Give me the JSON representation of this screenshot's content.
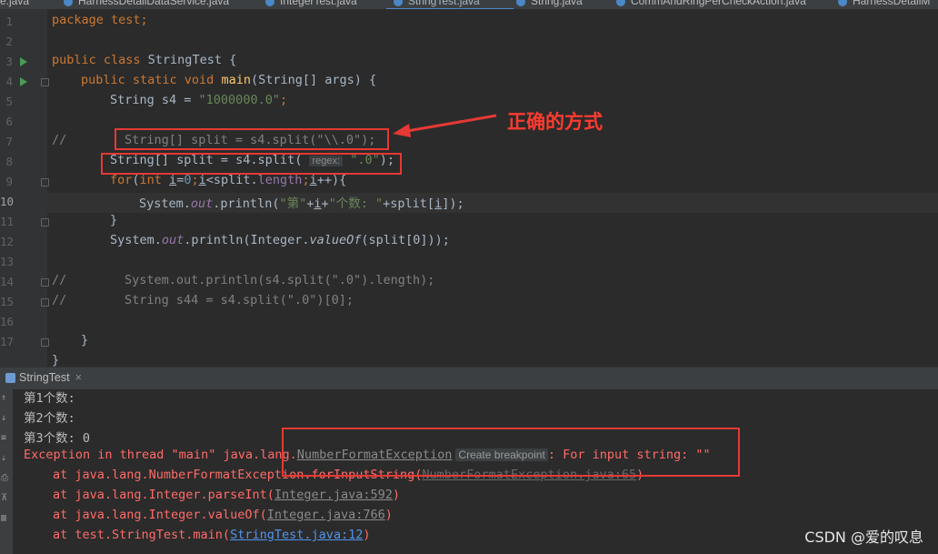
{
  "tabs": [
    {
      "label": "e.java"
    },
    {
      "label": "HarnessDetailDataService.java"
    },
    {
      "label": "IntegerTest.java"
    },
    {
      "label": "StringTest.java",
      "active": true
    },
    {
      "label": "String.java"
    },
    {
      "label": "CommAndRingPerCheckAction.java"
    },
    {
      "label": "HarnessDetailM"
    }
  ],
  "editor": {
    "line_numbers": [
      "1",
      "2",
      "3",
      "4",
      "5",
      "6",
      "7",
      "8",
      "9",
      "10",
      "11",
      "12",
      "13",
      "14",
      "15",
      "16",
      "17"
    ],
    "code": {
      "l1": "package test;",
      "l3_kw": "public class ",
      "l3_cls": "StringTest {",
      "l4_kw": "public static void ",
      "l4_fn": "main",
      "l4_rest": "(String[] args) {",
      "l5_a": "String s4 = ",
      "l5_str": "\"1000000.0\"",
      "l5_end": ";",
      "l7_comment": "//",
      "l7_code": "String[] split = s4.split(\"\\\\.0\");",
      "l8_a": "String[] split = s4.split(",
      "l8_hint": "regex:",
      "l8_str": "\".0\"",
      "l8_end": ");",
      "l9_for": "for",
      "l9_int": "int ",
      "l9_i": "i",
      "l9_eq": "=",
      "l9_zero": "0",
      "l9_semi": ";",
      "l9_i2": "i",
      "l9_mid": "<split.",
      "l9_len": "length",
      "l9_semi2": ";",
      "l9_i3": "i",
      "l9_end": "++){",
      "l10_a": "System.",
      "l10_out": "out",
      "l10_b": ".println(",
      "l10_s1": "\"第\"",
      "l10_plus1": "+",
      "l10_i": "i",
      "l10_plus2": "+",
      "l10_s2": "\"个数: \"",
      "l10_c": "+split[",
      "l10_i2": "i",
      "l10_end": "]);",
      "l11": "}",
      "l12_a": "System.",
      "l12_out": "out",
      "l12_b": ".println(Integer.",
      "l12_fn": "valueOf",
      "l12_end": "(split[0]));",
      "l14_comment": "//",
      "l14_code": "System.out.println(s4.split(\".0\").length);",
      "l15_comment": "//",
      "l15_code": "String s44 = s4.split(\".0\")[0];",
      "l17": "}",
      "l18": "}"
    },
    "note": "正确的方式"
  },
  "run_panel": {
    "tab_label": "StringTest",
    "lines": {
      "o1": "第1个数:",
      "o2": "第2个数:",
      "o3": "第3个数: 0",
      "ex_a": "Exception in thread \"main\" java.lang.",
      "ex_link": "NumberFormatException",
      "ex_hint": "Create breakpoint",
      "ex_b": ": For input string: \"\"",
      "t1_a": "at java.lang.NumberFormatException.forInputString(",
      "t1_link": "NumberFormatException.java:65",
      "t1_end": ")",
      "t2_a": "at java.lang.Integer.parseInt(",
      "t2_link": "Integer.java:592",
      "t2_end": ")",
      "t3_a": "at java.lang.Integer.valueOf(",
      "t3_link": "Integer.java:766",
      "t3_end": ")",
      "t4_a": "at test.StringTest.main(",
      "t4_link": "StringTest.java:12",
      "t4_end": ")"
    }
  },
  "watermark": "CSDN @爱的叹息"
}
